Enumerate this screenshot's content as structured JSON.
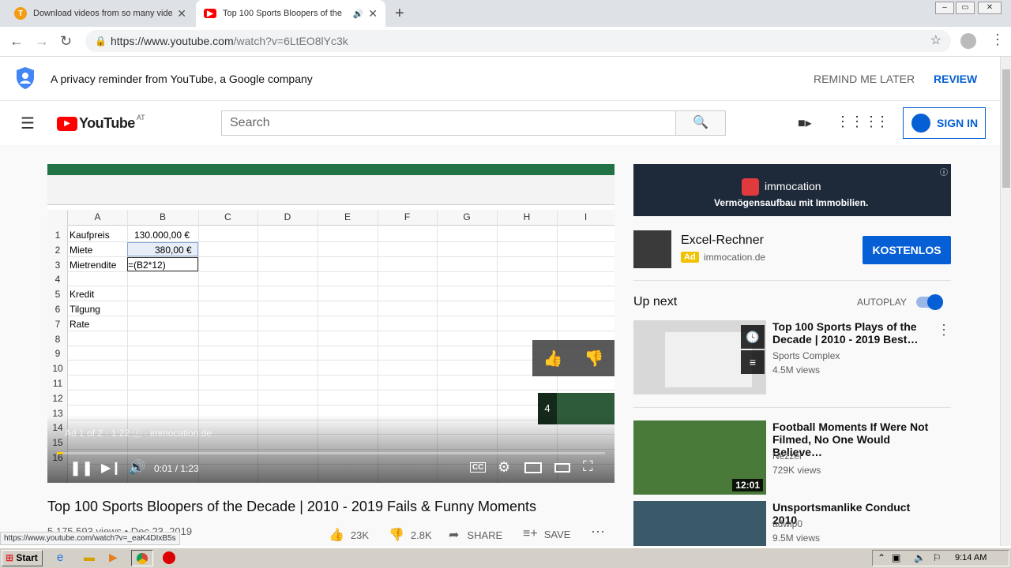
{
  "browser": {
    "tabs": [
      {
        "title": "Download videos from so many video",
        "active": false
      },
      {
        "title": "Top 100 Sports Bloopers of the",
        "active": true
      }
    ],
    "url_host": "https://www.youtube.com",
    "url_path": "/watch?v=6LtEO8lYc3k"
  },
  "privacy": {
    "message": "A privacy reminder from YouTube, a Google company",
    "remind_later": "REMIND ME LATER",
    "review": "REVIEW"
  },
  "header": {
    "logo_text": "YouTube",
    "country": "AT",
    "search_placeholder": "Search",
    "sign_in": "SIGN IN"
  },
  "player": {
    "ad_info": "Ad 1 of 2 · 1:22 ⓘ · immocation.de",
    "time": "0:01 / 1:23",
    "progress": 0.012,
    "skip_count": "4",
    "spreadsheet": {
      "columns": [
        "A",
        "B",
        "C",
        "D",
        "E",
        "F",
        "G",
        "H",
        "I"
      ],
      "rows": [
        "1",
        "2",
        "3",
        "4",
        "5",
        "6",
        "7",
        "8",
        "9",
        "10",
        "11",
        "12",
        "13",
        "14",
        "15",
        "16"
      ],
      "a1": "Kaufpreis",
      "b1": "130.000,00 €",
      "a2": "Miete",
      "b2": "380,00 €",
      "a3": "Mietrendite",
      "b3": "=(B2*12)",
      "a5": "Kredit",
      "a6": "Tilgung",
      "a7": "Rate"
    }
  },
  "video": {
    "title": "Top 100 Sports Bloopers of the Decade | 2010 - 2019 Fails & Funny Moments",
    "views": "5,175,593 views • Dec 23, 2019",
    "likes": "23K",
    "dislikes": "2.8K",
    "share": "SHARE",
    "save": "SAVE"
  },
  "ad": {
    "banner_brand": "immocation",
    "banner_tagline": "Vermögensaufbau mit Immobilien.",
    "title": "Excel-Rechner",
    "badge": "Ad",
    "domain": "immocation.de",
    "cta": "KOSTENLOS"
  },
  "upnext": {
    "label": "Up next",
    "autoplay": "AUTOPLAY",
    "items": [
      {
        "title": "Top 100 Sports Plays of the Decade | 2010 - 2019 Best…",
        "channel": "Sports Complex",
        "views": "4.5M views",
        "duration": ""
      },
      {
        "title": "Football Moments If Were Not Filmed, No One Would Believe…",
        "channel": "Nezzer",
        "views": "729K views",
        "duration": "12:01"
      },
      {
        "title": "Unsportsmanlike Conduct 2010",
        "channel": "adwip0",
        "views": "9.5M views",
        "duration": ""
      }
    ]
  },
  "status_url": "https://www.youtube.com/watch?v=_eaK4DIxB5s",
  "taskbar": {
    "start": "Start",
    "clock": "9:14 AM"
  },
  "colors": {
    "yt_red": "#ff0000",
    "link_blue": "#065fd4",
    "cta_blue": "#065fd4"
  }
}
